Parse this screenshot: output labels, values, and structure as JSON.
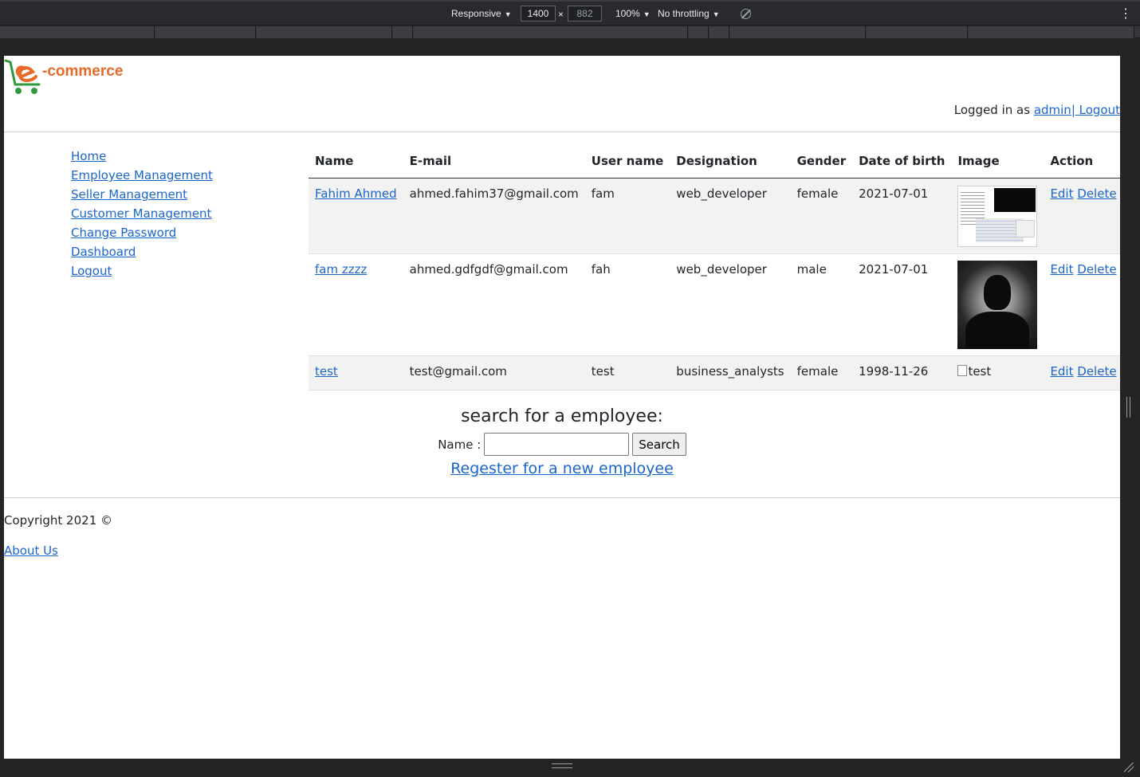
{
  "devtools": {
    "device": "Responsive",
    "width": "1400",
    "height": "882",
    "zoom": "100%",
    "throttling": "No throttling"
  },
  "header": {
    "logo_text": "-commerce",
    "logged_in_prefix": "Logged in as ",
    "username": "admin",
    "logout": "| Logout"
  },
  "sidebar": {
    "items": [
      {
        "label": "Home"
      },
      {
        "label": "Employee Management"
      },
      {
        "label": "Seller Management"
      },
      {
        "label": "Customer Management"
      },
      {
        "label": "Change Password"
      },
      {
        "label": "Dashboard"
      },
      {
        "label": "Logout"
      }
    ]
  },
  "table": {
    "columns": [
      "Name",
      "E-mail",
      "User name",
      "Designation",
      "Gender",
      "Date of birth",
      "Image",
      "Action"
    ],
    "rows": [
      {
        "name": "Fahim Ahmed",
        "email": "ahmed.fahim37@gmail.com",
        "username": "fam",
        "designation": "web_developer",
        "gender": "female",
        "dob": "2021-07-01",
        "image": "screenshot",
        "edit": "Edit",
        "delete": "Delete"
      },
      {
        "name": "fam zzzz",
        "email": "ahmed.gdfgdf@gmail.com",
        "username": "fah",
        "designation": "web_developer",
        "gender": "male",
        "dob": "2021-07-01",
        "image": "avatar",
        "edit": "Edit",
        "delete": "Delete"
      },
      {
        "name": "test",
        "email": "test@gmail.com",
        "username": "test",
        "designation": "business_analysts",
        "gender": "female",
        "dob": "1998-11-26",
        "image_alt": "test",
        "edit": "Edit",
        "delete": "Delete"
      }
    ]
  },
  "search": {
    "heading": "search for a employee:",
    "label": "Name :",
    "value": "",
    "button": "Search",
    "register": "Regester for a new employee"
  },
  "footer": {
    "copyright": "Copyright 2021 ©",
    "about": "About Us"
  }
}
